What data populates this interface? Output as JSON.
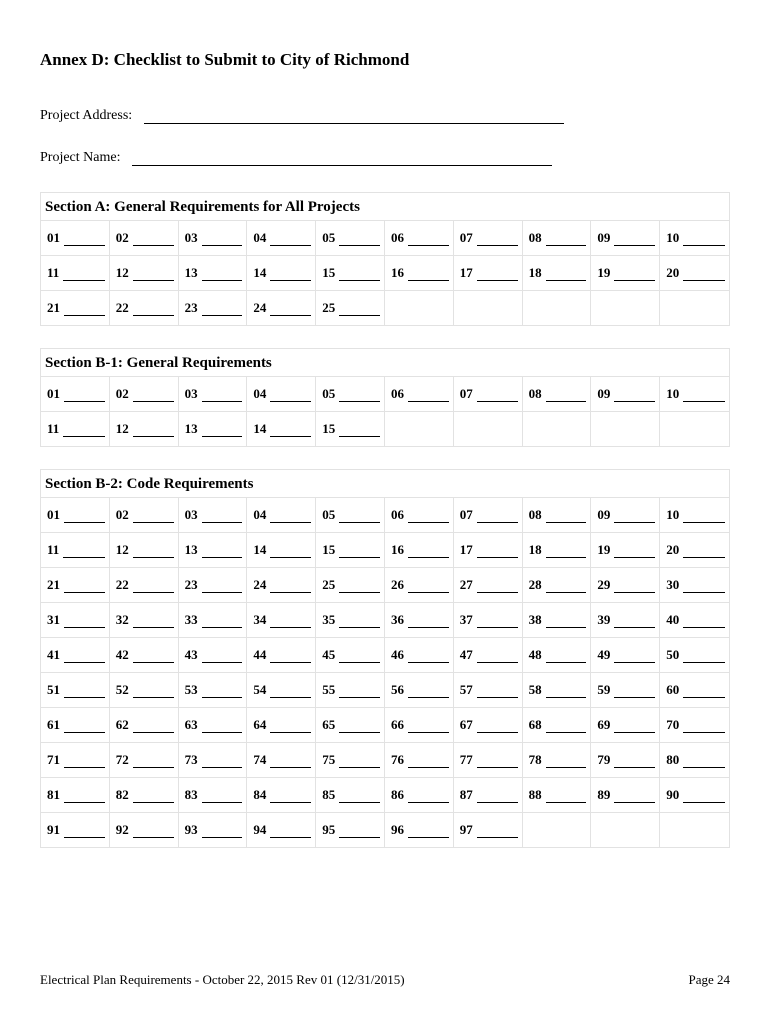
{
  "title": "Annex D: Checklist to Submit to City of Richmond",
  "fields": {
    "project_address_label": "Project Address:",
    "project_name_label": "Project Name:"
  },
  "sections": {
    "a": {
      "title": "Section A: General Requirements for All Projects",
      "count": 25,
      "columns": 10
    },
    "b1": {
      "title": "Section B-1: General Requirements",
      "count": 15,
      "columns": 10
    },
    "b2": {
      "title": "Section B-2: Code Requirements",
      "count": 97,
      "columns": 10
    }
  },
  "footer": {
    "left": "Electrical Plan Requirements - October 22, 2015 Rev 01 (12/31/2015)",
    "right": "Page 24"
  }
}
